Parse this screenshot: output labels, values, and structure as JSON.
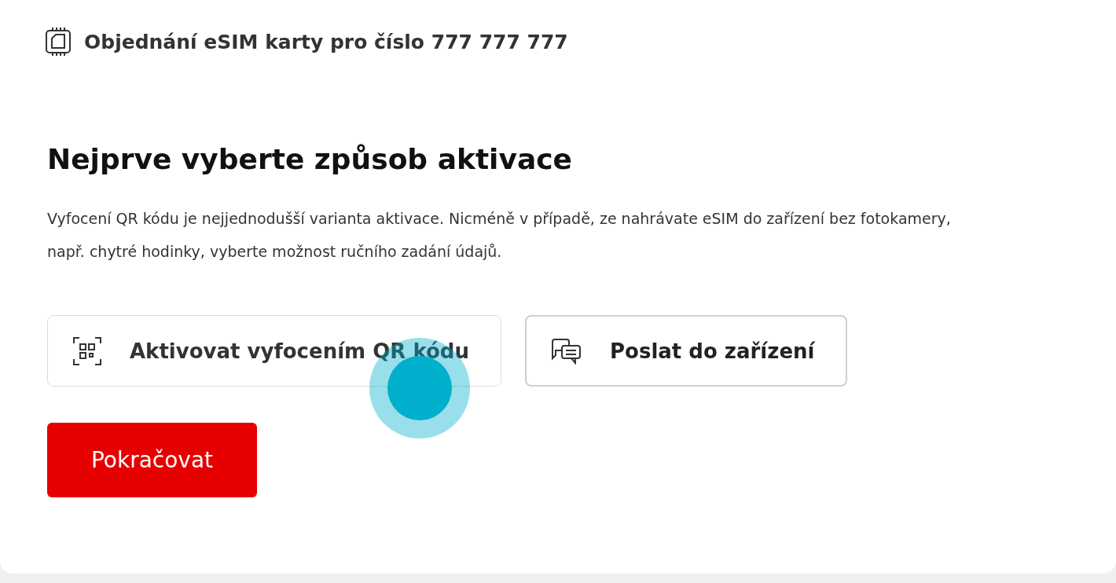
{
  "header": {
    "title": "Objednání eSIM karty pro číslo 777 777 777"
  },
  "heading": "Nejprve vyberte způsob aktivace",
  "description": "Vyfocení QR kódu je nejjednodušší varianta aktivace. Nicméně v případě, ze nahrávate eSIM do zařízení bez fotokamery, např. chytré hodinky, vyberte možnost ručního zadání údajů.",
  "options": [
    {
      "kind": "qr",
      "label": "Aktivovat vyfocením QR kódu",
      "selected": false
    },
    {
      "kind": "send",
      "label": "Poslat do zařízení",
      "selected": true
    }
  ],
  "continue_button": "Pokračovat"
}
